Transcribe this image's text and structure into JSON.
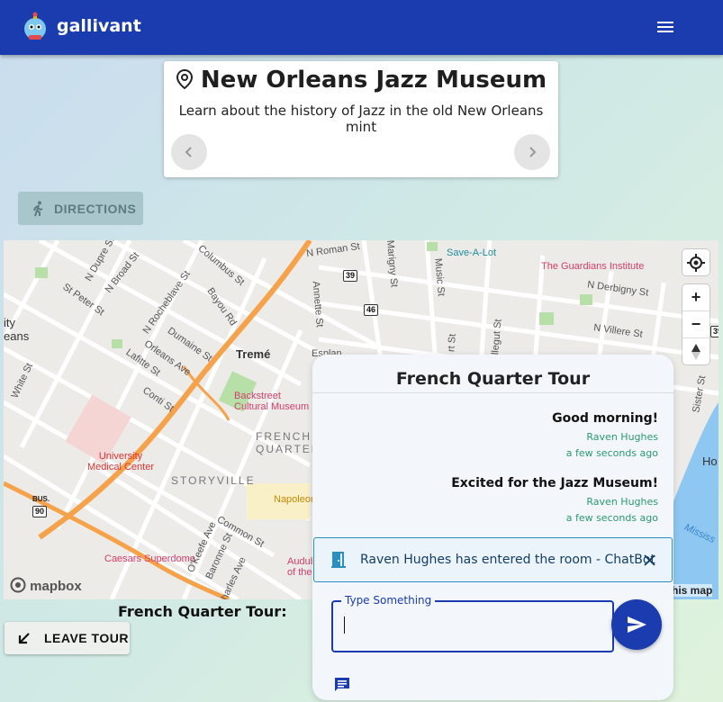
{
  "header": {
    "app_name": "gallivant",
    "logo_icon": "robot-mascot-icon",
    "menu_icon": "hamburger-menu-icon",
    "bg_color": "#1a3caf"
  },
  "location_card": {
    "title": "New Orleans Jazz Museum",
    "subtitle": "Learn about the history of Jazz in the old New Orleans mint",
    "title_icon": "map-pin-icon"
  },
  "directions_button": {
    "label": "DIRECTIONS",
    "icon": "walking-icon"
  },
  "map": {
    "labels": {
      "n_roman": "N Roman St",
      "save_a_lot": "Save-A-Lot",
      "guardians": "The Guardians Institute",
      "n_derbigny": "N Derbigny St",
      "n_villere": "N Villere St",
      "treme": "Tremé",
      "backstreet": "Backstreet\nCultural Museum",
      "french_quarter": "FRENCH\nQUARTER",
      "storyville": "STORYVILLE",
      "university": "University\nMedical Center",
      "napoleon": "Napoleon Hou",
      "caesars": "Caesars Superdome",
      "audubon": "Audubon Aq\nof the Am",
      "city": "ity\neans",
      "columbus": "Columbus St",
      "n_broad": "N Broad St",
      "n_dupre": "N Dupre St",
      "st_peter": "St Peter St",
      "n_rocheblave": "N Rocheblave St",
      "bayou": "Bayou Rd",
      "dumaine": "Dumaine St",
      "orleans": "Orleans Ave",
      "lafitte": "Lafitte St",
      "conti": "Conti St",
      "common": "Common St",
      "okeefe": "O'Keefe Ave",
      "baronne": "Baronne St",
      "charles": "harles Ave",
      "white": "White St",
      "marigny": "Marigny St",
      "music": "Music St",
      "annette": "Annette St",
      "esplan": "Esplan",
      "rt_st": "rt St",
      "allegut": "Allegut St",
      "sister": "Sister St",
      "mississ": "Mississ",
      "ho": "Ho",
      "shield_39a": "39",
      "shield_46": "46",
      "shield_39b": "39",
      "shield_90": "90",
      "bus": "BUS."
    },
    "mapbox_text": "mapbox",
    "attribution": "his map",
    "controls": {
      "locate_icon": "crosshair-locate-icon",
      "zoom_in": "+",
      "zoom_out": "−",
      "compass_icon": "compass-north-icon"
    }
  },
  "tour": {
    "heading": "French Quarter Tour:",
    "leave_label": "LEAVE TOUR",
    "leave_icon": "arrow-down-left-icon"
  },
  "chat": {
    "title": "French Quarter Tour",
    "messages": [
      {
        "text": "Good morning!",
        "author": "Raven Hughes",
        "time": "a few seconds ago"
      },
      {
        "text": "Excited for the Jazz Museum!",
        "author": "Raven Hughes",
        "time": "a few seconds ago"
      }
    ],
    "notice": {
      "text": "Raven Hughes has entered the room - ChatBot",
      "icon": "door-enter-icon",
      "close_icon": "close-icon"
    },
    "input": {
      "legend": "Type Something",
      "value": ""
    },
    "send_icon": "send-icon",
    "chat_icon": "chat-bubble-icon",
    "accent": "#1a3caf",
    "author_color": "#2b9a6a"
  }
}
